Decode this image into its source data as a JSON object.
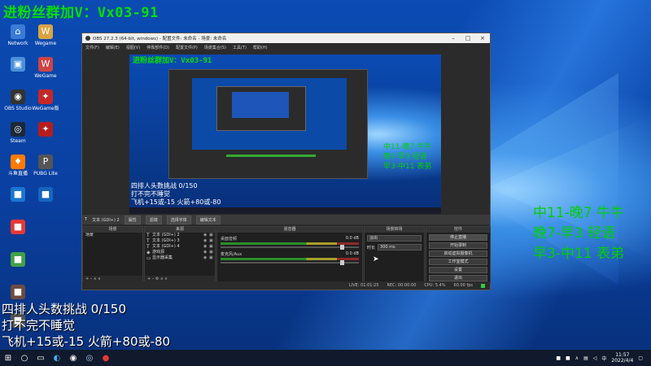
{
  "overlay": {
    "top_text": "进粉丝群加V：Vx03-91",
    "right_lines": [
      "中11-晚7 牛牛",
      "晚7-早3 轻语",
      "早3-中11 表弟"
    ],
    "left_lines": [
      "四排人头数挑战 0/150",
      "打不完不睡觉",
      "飞机+15或-15 火箭+80或-80"
    ]
  },
  "desktop_icons": [
    {
      "label": "Network",
      "icon": "network-icon",
      "color": "#3a7bd5"
    },
    {
      "label": "Wegame",
      "icon": "wegame-icon",
      "color": "#d9a441"
    },
    {
      "label": "",
      "icon": "computer-icon",
      "color": "#4a90d9"
    },
    {
      "label": "WeGame",
      "icon": "wegame-icon",
      "color": "#cc4444"
    },
    {
      "label": "OBS Studio",
      "icon": "obs-icon",
      "color": "#333333"
    },
    {
      "label": "WeGame版",
      "icon": "game-icon",
      "color": "#c62828"
    },
    {
      "label": "Steam",
      "icon": "steam-icon",
      "color": "#1b2838"
    },
    {
      "label": "",
      "icon": "game-icon",
      "color": "#b71c1c"
    },
    {
      "label": "斗鱼直播",
      "icon": "douyu-icon",
      "color": "#ff7a00"
    },
    {
      "label": "PUBG Lite",
      "icon": "pubg-icon",
      "color": "#555555"
    },
    {
      "label": "",
      "icon": "app-icon",
      "color": "#1976d2"
    },
    {
      "label": "",
      "icon": "app-icon",
      "color": "#1565c0"
    },
    {
      "label": "",
      "icon": "app-icon",
      "color": "#e53935"
    },
    {
      "label": "",
      "icon": "app-icon",
      "color": "#43a047"
    },
    {
      "label": "",
      "icon": "app-icon",
      "color": "#6d4c41"
    },
    {
      "label": "",
      "icon": "app-icon",
      "color": "#555555"
    }
  ],
  "obs": {
    "title": "OBS 27.2.3 (64-bit, windows) - 配置文件: 未命名 - 场景: 未命名",
    "menu": [
      "文件(F)",
      "编辑(E)",
      "视图(V)",
      "停靠部件(D)",
      "配置文件(P)",
      "场景集合(S)",
      "工具(T)",
      "帮助(H)"
    ],
    "preview_top_text": "进粉丝群加V：Vx03-91",
    "source_toolbar": {
      "selected_source": "文本 (GDI+) 2",
      "properties": "属性",
      "filters": "滤镜",
      "select_text": "选择字体",
      "edit_text": "编辑文本"
    },
    "docks": {
      "scenes": {
        "title": "场景",
        "items": [
          "场景"
        ]
      },
      "sources": {
        "title": "来源",
        "items": [
          "文本 (GDI+) 2",
          "文本 (GDI+) 3",
          "文本 (GDI+) 4",
          "游戏源",
          "显示器采集"
        ]
      },
      "mixer": {
        "title": "混音器",
        "tracks": [
          {
            "name": "桌面音频",
            "db": "0.0 dB"
          },
          {
            "name": "麦克风/Aux",
            "db": "0.0 dB"
          }
        ]
      },
      "transitions": {
        "title": "场景转场",
        "selected": "淡出",
        "duration_label": "时长",
        "duration": "300 ms"
      },
      "controls": {
        "title": "控件",
        "buttons": [
          "停止直播",
          "开始录制",
          "启动虚拟摄像机",
          "工作室模式",
          "设置",
          "退出"
        ]
      }
    },
    "status": {
      "live": "LIVE: 01:01:25",
      "rec": "REC: 00:00:00",
      "cpu": "CPU: 5.4%",
      "fps": "60.00 fps"
    }
  },
  "taskbar": {
    "time": "11:57",
    "date": "2022/4/4",
    "lang": "中"
  }
}
